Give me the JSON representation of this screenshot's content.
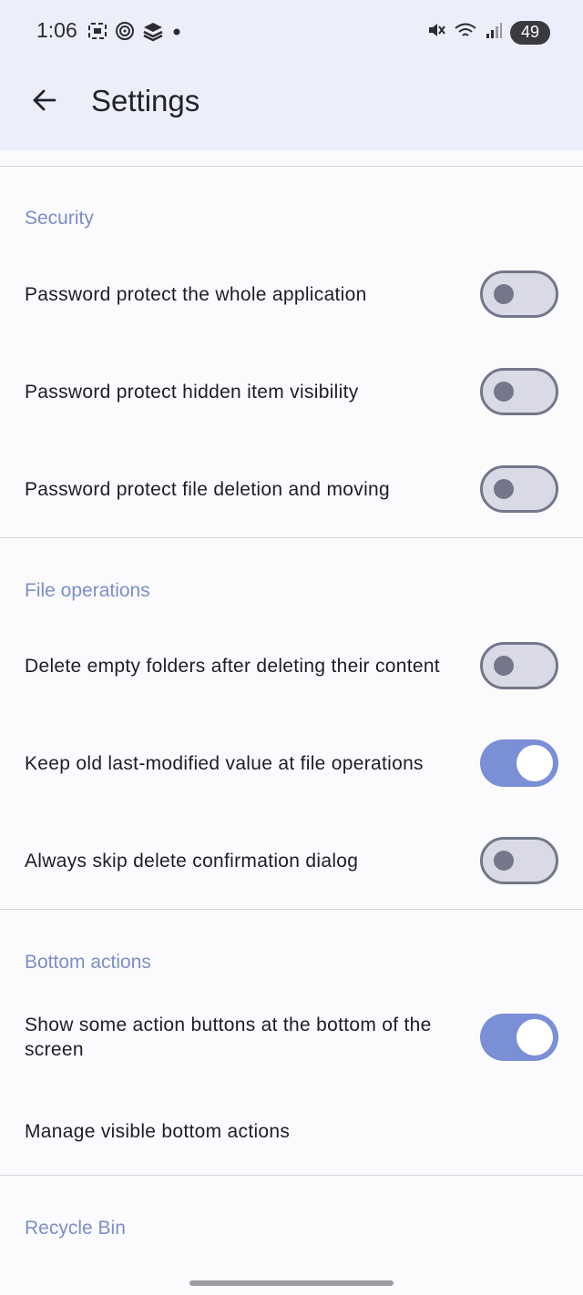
{
  "status_bar": {
    "time": "1:06",
    "battery": "49"
  },
  "app_bar": {
    "title": "Settings"
  },
  "sections": {
    "security": {
      "header": "Security",
      "items": [
        {
          "label": "Password protect the whole application",
          "enabled": false
        },
        {
          "label": "Password protect hidden item visibility",
          "enabled": false
        },
        {
          "label": "Password protect file deletion and moving",
          "enabled": false
        }
      ]
    },
    "file_operations": {
      "header": "File operations",
      "items": [
        {
          "label": "Delete empty folders after deleting their content",
          "enabled": false
        },
        {
          "label": "Keep old last-modified value at file operations",
          "enabled": true
        },
        {
          "label": "Always skip delete confirmation dialog",
          "enabled": false
        }
      ]
    },
    "bottom_actions": {
      "header": "Bottom actions",
      "items": [
        {
          "label": "Show some action buttons at the bottom of the screen",
          "enabled": true
        },
        {
          "label": "Manage visible bottom actions"
        }
      ]
    },
    "recycle_bin": {
      "header": "Recycle Bin"
    }
  },
  "colors": {
    "app_bar_bg": "#eceefc",
    "accent": "#7b8fd6",
    "section_header": "#7c8ec8",
    "switch_off_track": "#d9dae5",
    "switch_off_border": "#737789"
  },
  "icons": [
    "screenshot-icon",
    "spiral-icon",
    "stack-icon",
    "mute-icon",
    "wifi-icon",
    "signal-icon",
    "back-arrow-icon"
  ]
}
